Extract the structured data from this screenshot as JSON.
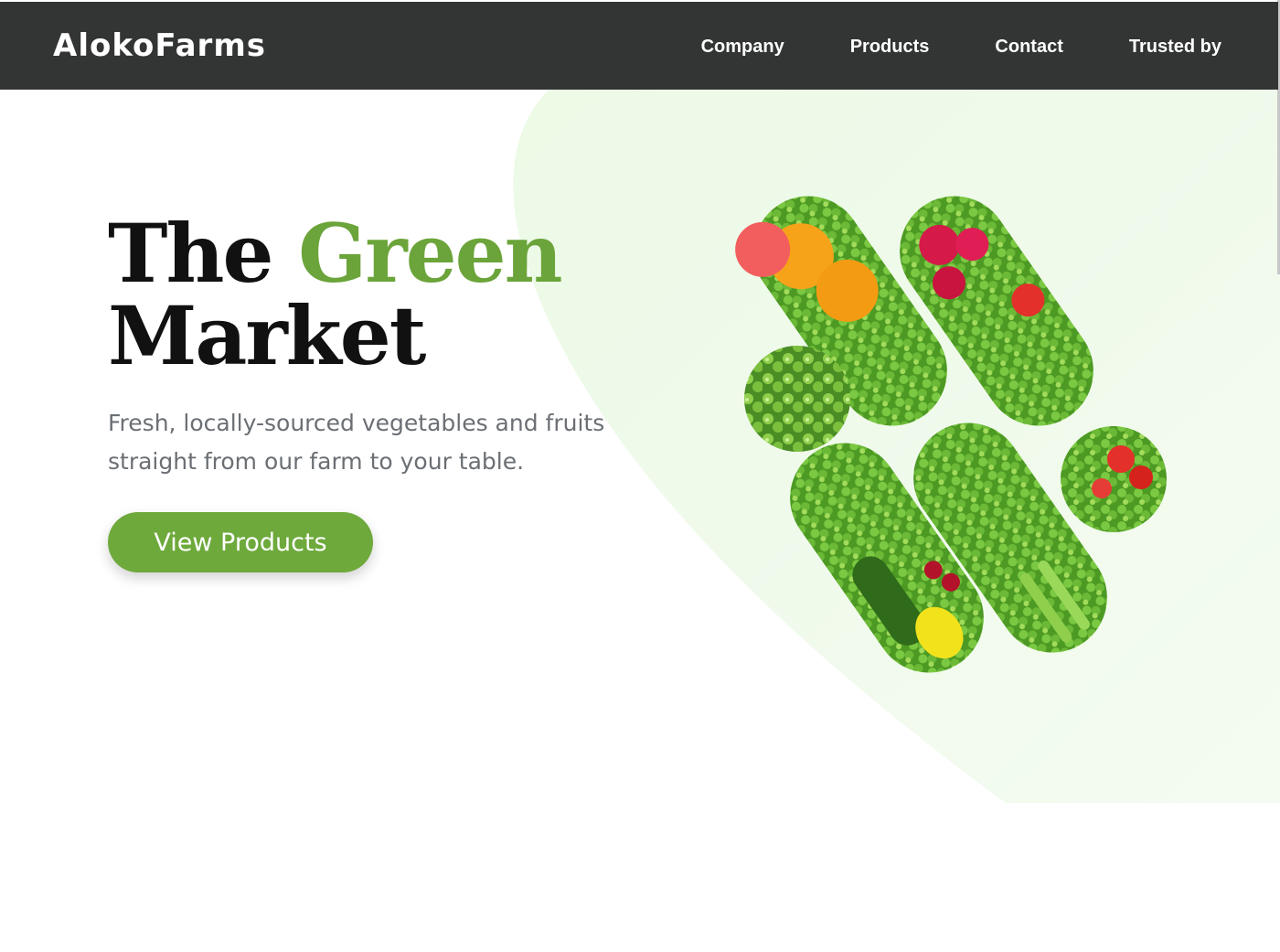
{
  "header": {
    "brand": "AlokoFarms",
    "nav": [
      "Company",
      "Products",
      "Contact",
      "Trusted by"
    ]
  },
  "hero": {
    "title_line1_a": "The",
    "title_line1_b": "Green",
    "title_line2": "Market",
    "subtitle": "Fresh, locally-sourced vegetables and fruits straight from our farm to your table.",
    "cta_label": "View Products"
  },
  "colors": {
    "header_bg": "#333434",
    "accent_green": "#6ba43a",
    "button_green": "#6ea93c",
    "soft_bg": "#eef9ea"
  }
}
